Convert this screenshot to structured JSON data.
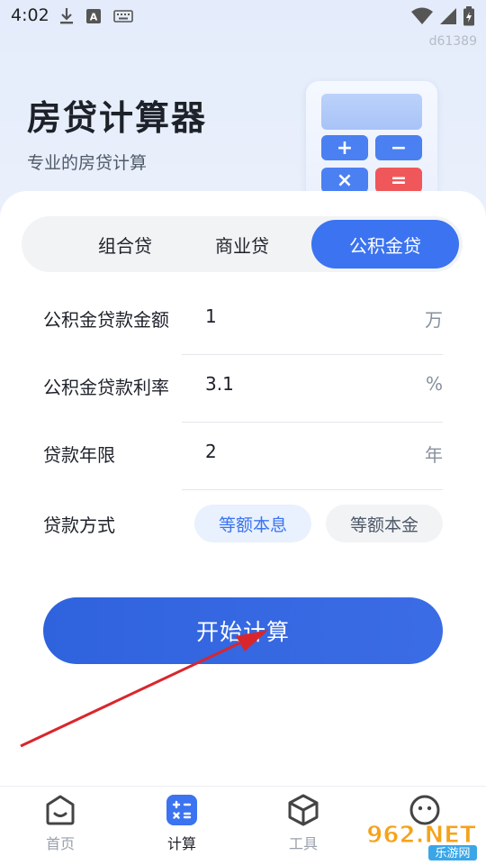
{
  "status_bar": {
    "time": "4:02",
    "code": "d61389"
  },
  "header": {
    "title": "房贷计算器",
    "subtitle": "专业的房贷计算"
  },
  "calculator_keys": {
    "plus": "+",
    "minus": "−",
    "times": "×",
    "equals": "="
  },
  "tabs": [
    {
      "label": "组合贷",
      "active": false
    },
    {
      "label": "商业贷",
      "active": false
    },
    {
      "label": "公积金贷",
      "active": true
    }
  ],
  "form": {
    "amount": {
      "label": "公积金贷款金额",
      "value": "1",
      "unit": "万"
    },
    "rate": {
      "label": "公积金贷款利率",
      "value": "3.1",
      "unit": "%"
    },
    "years": {
      "label": "贷款年限",
      "value": "2",
      "unit": "年"
    },
    "method": {
      "label": "贷款方式",
      "options": [
        {
          "label": "等额本息",
          "selected": true
        },
        {
          "label": "等额本金",
          "selected": false
        }
      ]
    }
  },
  "calculate_button": {
    "label": "开始计算"
  },
  "bottom_nav": [
    {
      "label": "首页",
      "icon": "home-icon",
      "active": false
    },
    {
      "label": "计算",
      "icon": "calculator-icon",
      "active": true
    },
    {
      "label": "工具",
      "icon": "cube-icon",
      "active": false
    },
    {
      "label": "",
      "icon": "chat-face-icon",
      "active": false
    }
  ],
  "watermark": {
    "text": "962.NET",
    "subtext": "乐游网"
  },
  "colors": {
    "accent": "#3b73f0",
    "button": "#2f63dd",
    "annotation": "#d9262c"
  }
}
